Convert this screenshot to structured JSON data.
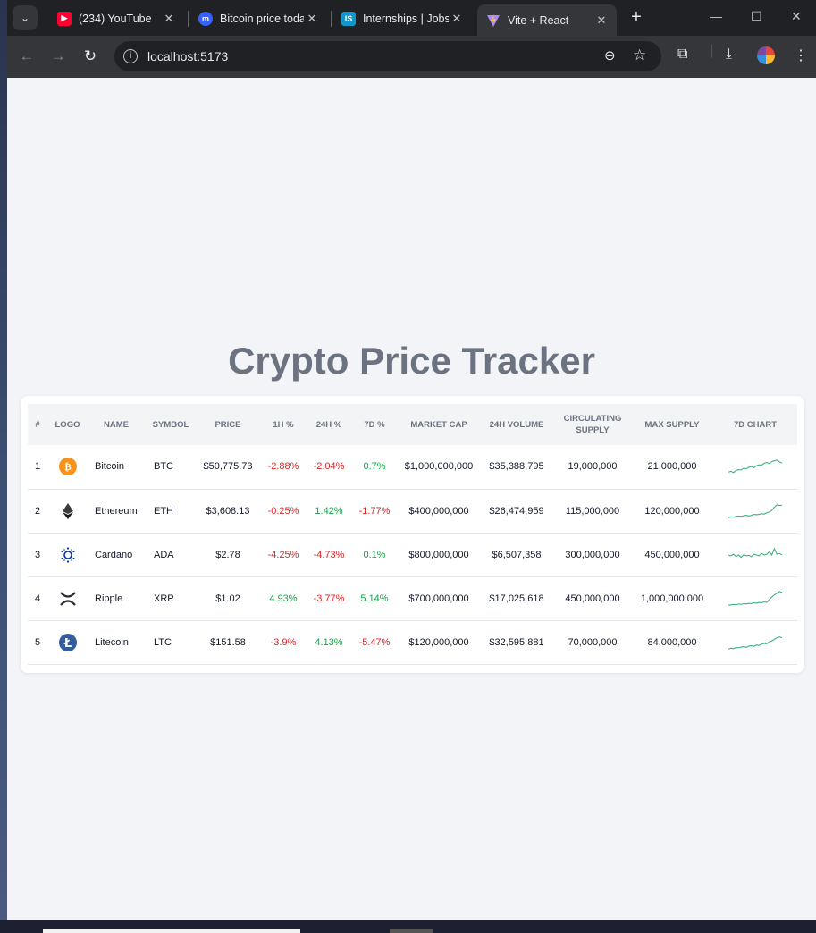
{
  "browser": {
    "tabs": [
      {
        "title": "(234) YouTube",
        "icon": "youtube-icon",
        "color": "#ff0033",
        "glyph": "▶"
      },
      {
        "title": "Bitcoin price toda",
        "icon": "coinmarketcap-icon",
        "color": "#3861fb",
        "glyph": "m"
      },
      {
        "title": "Internships | Jobs",
        "icon": "internshala-icon",
        "color": "#1295c9",
        "glyph": "IS"
      },
      {
        "title": "Vite + React",
        "icon": "vite-icon",
        "color": "#8b5cf6",
        "glyph": "▼"
      }
    ],
    "active_tab": 3,
    "url": "localhost:5173"
  },
  "page": {
    "title": "Crypto Price Tracker"
  },
  "table": {
    "headers": {
      "rank": "#",
      "logo": "LOGO",
      "name": "NAME",
      "symbol": "SYMBOL",
      "price": "PRICE",
      "h1": "1H %",
      "h24": "24H %",
      "d7": "7D %",
      "market_cap": "MARKET CAP",
      "volume": "24H VOLUME",
      "circulating": "CIRCULATING SUPPLY",
      "max_supply": "MAX SUPPLY",
      "chart": "7D CHART"
    },
    "rows": [
      {
        "rank": "1",
        "name": "Bitcoin",
        "symbol": "BTC",
        "price": "$50,775.73",
        "h1": "-2.88%",
        "h24": "-2.04%",
        "d7": "0.7%",
        "market_cap": "$1,000,000,000",
        "volume": "$35,388,795",
        "circulating": "19,000,000",
        "max_supply": "21,000,000",
        "logo_color": "#f7931a",
        "logo_icon": "bitcoin-icon",
        "spark": [
          0.15,
          0.2,
          0.12,
          0.25,
          0.3,
          0.28,
          0.4,
          0.35,
          0.45,
          0.5,
          0.42,
          0.55,
          0.6,
          0.58,
          0.7,
          0.75,
          0.68,
          0.8,
          0.85,
          0.9,
          0.78,
          0.72
        ]
      },
      {
        "rank": "2",
        "name": "Ethereum",
        "symbol": "ETH",
        "price": "$3,608.13",
        "h1": "-0.25%",
        "h24": "1.42%",
        "d7": "-1.77%",
        "market_cap": "$400,000,000",
        "volume": "$26,474,959",
        "circulating": "115,000,000",
        "max_supply": "120,000,000",
        "logo_color": "#3c3c3d",
        "logo_icon": "ethereum-icon",
        "spark": [
          0.1,
          0.15,
          0.12,
          0.18,
          0.2,
          0.17,
          0.22,
          0.25,
          0.2,
          0.24,
          0.3,
          0.28,
          0.3,
          0.35,
          0.32,
          0.4,
          0.45,
          0.55,
          0.75,
          0.9,
          0.85,
          0.88
        ]
      },
      {
        "rank": "3",
        "name": "Cardano",
        "symbol": "ADA",
        "price": "$2.78",
        "h1": "-4.25%",
        "h24": "-4.73%",
        "d7": "0.1%",
        "market_cap": "$800,000,000",
        "volume": "$6,507,358",
        "circulating": "300,000,000",
        "max_supply": "450,000,000",
        "logo_color": "#0033ad",
        "logo_icon": "cardano-icon",
        "spark": [
          0.5,
          0.45,
          0.55,
          0.4,
          0.5,
          0.35,
          0.52,
          0.45,
          0.48,
          0.4,
          0.55,
          0.5,
          0.45,
          0.6,
          0.5,
          0.55,
          0.7,
          0.5,
          0.9,
          0.55,
          0.6,
          0.5
        ]
      },
      {
        "rank": "4",
        "name": "Ripple",
        "symbol": "XRP",
        "price": "$1.02",
        "h1": "4.93%",
        "h24": "-3.77%",
        "d7": "5.14%",
        "market_cap": "$700,000,000",
        "volume": "$17,025,618",
        "circulating": "450,000,000",
        "max_supply": "1,000,000,000",
        "logo_color": "#23292f",
        "logo_icon": "ripple-icon",
        "spark": [
          0.1,
          0.12,
          0.15,
          0.12,
          0.18,
          0.15,
          0.2,
          0.18,
          0.22,
          0.2,
          0.25,
          0.22,
          0.28,
          0.25,
          0.3,
          0.28,
          0.45,
          0.6,
          0.75,
          0.85,
          0.95,
          0.9
        ]
      },
      {
        "rank": "5",
        "name": "Litecoin",
        "symbol": "LTC",
        "price": "$151.58",
        "h1": "-3.9%",
        "h24": "4.13%",
        "d7": "-5.47%",
        "market_cap": "$120,000,000",
        "volume": "$32,595,881",
        "circulating": "70,000,000",
        "max_supply": "84,000,000",
        "logo_color": "#345d9d",
        "logo_icon": "litecoin-icon",
        "spark": [
          0.1,
          0.15,
          0.12,
          0.2,
          0.18,
          0.22,
          0.25,
          0.2,
          0.28,
          0.3,
          0.27,
          0.35,
          0.32,
          0.4,
          0.45,
          0.42,
          0.55,
          0.6,
          0.7,
          0.8,
          0.85,
          0.8
        ]
      }
    ]
  },
  "colors": {
    "positive": "#16a34a",
    "negative": "#dc2626",
    "spark": "#3fb27f"
  }
}
